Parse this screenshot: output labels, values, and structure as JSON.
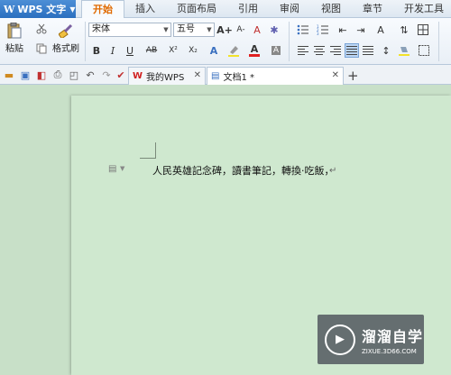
{
  "app": {
    "name": "WPS 文字"
  },
  "menu_tabs": [
    "开始",
    "插入",
    "页面布局",
    "引用",
    "审阅",
    "视图",
    "章节",
    "开发工具"
  ],
  "ribbon": {
    "paste_label": "粘贴",
    "format_painter_label": "格式刷",
    "font_name": "宋体",
    "font_size": "五号",
    "font_grow": "A+",
    "font_shrink": "A-",
    "bold": "B",
    "italic": "I",
    "underline": "U",
    "strikethrough": "AB",
    "superscript": "X²",
    "subscript": "X₂",
    "font_color": "A",
    "clear_format": "A"
  },
  "doc_tabs": [
    {
      "label": "我的WPS"
    },
    {
      "label": "文档1 *"
    }
  ],
  "document": {
    "text": "人民英雄記念碑，讀書筆記，轉換·吃飯，",
    "para_mark": "↵"
  },
  "watermark": {
    "title": "溜溜自学",
    "url": "ZIXUE.3D66.COM"
  },
  "colors": {
    "app_blue": "#2b6fbf",
    "active_tab": "#e06a00",
    "page_bg": "#cfe8cf",
    "font_color_red": "#e02020",
    "highlight_yellow": "#f2e22a"
  }
}
